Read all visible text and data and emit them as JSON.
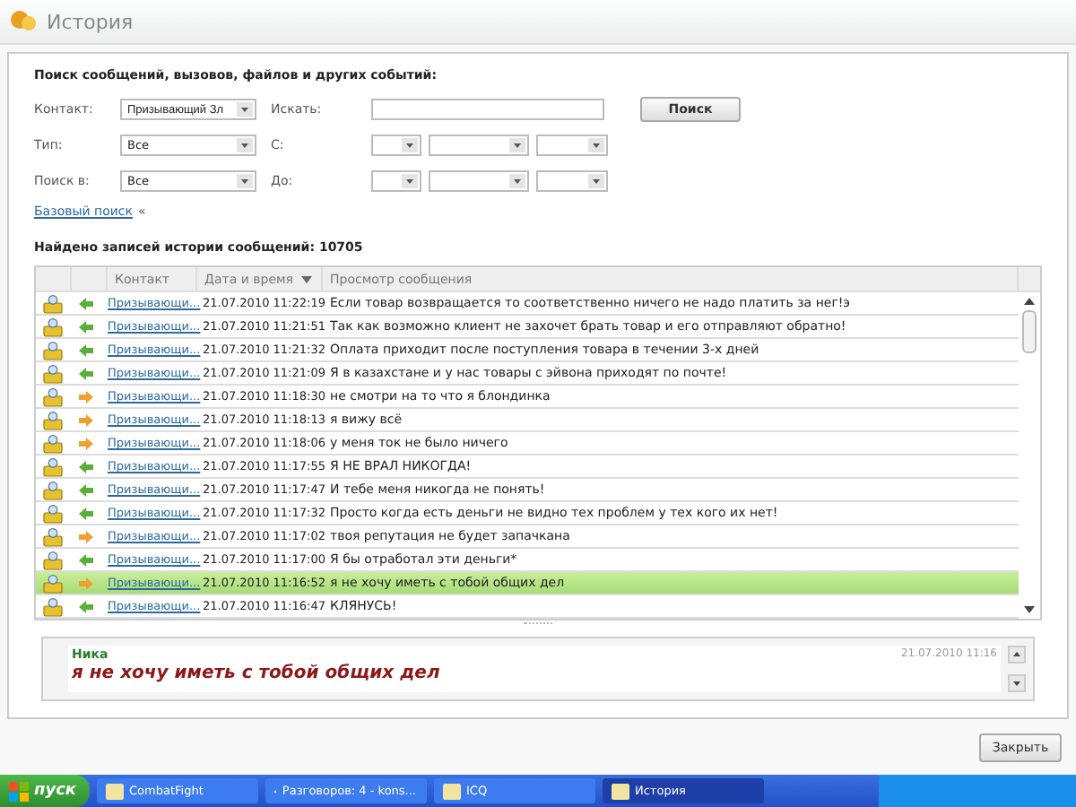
{
  "window": {
    "title": "История"
  },
  "search": {
    "heading": "Поиск сообщений, вызовов, файлов и других событий:",
    "contact_label": "Контакт:",
    "contact_value": "Призывающий Зл",
    "query_label": "Искать:",
    "search_button": "Поиск",
    "type_label": "Тип:",
    "type_value": "Все",
    "from_label": "С:",
    "in_label": "Поиск в:",
    "in_value": "Все",
    "to_label": "До:",
    "basic_link": "Базовый поиск",
    "basic_arrow": "«"
  },
  "found": "Найдено записей истории сообщений: 10705",
  "table": {
    "columns": [
      "Контакт",
      "Дата и время",
      "Просмотр сообщения"
    ],
    "rows": [
      {
        "kind": "incoming",
        "contact": "Призывающи...",
        "time": "21.07.2010 11:22:19",
        "text": "Если товар возвращается то соответственно ничего не надо платить за нег!э",
        "selected": false
      },
      {
        "kind": "incoming",
        "contact": "Призывающи...",
        "time": "21.07.2010 11:21:51",
        "text": "Так как возможно клиент не захочет брать товар и его отправляют обратно!",
        "selected": false
      },
      {
        "kind": "incoming",
        "contact": "Призывающи...",
        "time": "21.07.2010 11:21:32",
        "text": "Оплата приходит после поступления товара в течении 3-х дней",
        "selected": false
      },
      {
        "kind": "incoming",
        "contact": "Призывающи...",
        "time": "21.07.2010 11:21:09",
        "text": "Я в казахстане и у нас товары с эйвона приходят по почте!",
        "selected": false
      },
      {
        "kind": "outgoing",
        "contact": "Призывающи...",
        "time": "21.07.2010 11:18:30",
        "text": "не смотри на то что я блондинка",
        "selected": false
      },
      {
        "kind": "outgoing",
        "contact": "Призывающи...",
        "time": "21.07.2010 11:18:13",
        "text": "я вижу всё",
        "selected": false
      },
      {
        "kind": "outgoing",
        "contact": "Призывающи...",
        "time": "21.07.2010 11:18:06",
        "text": "у меня ток не было ничего",
        "selected": false
      },
      {
        "kind": "incoming",
        "contact": "Призывающи...",
        "time": "21.07.2010 11:17:55",
        "text": "Я НЕ ВРАЛ НИКОГДА!",
        "selected": false
      },
      {
        "kind": "incoming",
        "contact": "Призывающи...",
        "time": "21.07.2010 11:17:47",
        "text": "И тебе меня никогда не понять!",
        "selected": false
      },
      {
        "kind": "incoming",
        "contact": "Призывающи...",
        "time": "21.07.2010 11:17:32",
        "text": "Просто когда есть деньги не видно тех проблем у тех кого их нет!",
        "selected": false
      },
      {
        "kind": "outgoing",
        "contact": "Призывающи...",
        "time": "21.07.2010 11:17:02",
        "text": "твоя репутация не будет запачкана",
        "selected": false
      },
      {
        "kind": "incoming",
        "contact": "Призывающи...",
        "time": "21.07.2010 11:17:00",
        "text": "Я бы отработал эти деньги*",
        "selected": false
      },
      {
        "kind": "outgoing",
        "contact": "Призывающи...",
        "time": "21.07.2010 11:16:52",
        "text": "я не хочу иметь с тобой общих дел",
        "selected": true
      },
      {
        "kind": "incoming",
        "contact": "Призывающи...",
        "time": "21.07.2010 11:16:47",
        "text": "КЛЯНУСЬ!",
        "selected": false
      }
    ]
  },
  "preview": {
    "sender": "Ника",
    "time": "21.07.2010 11:16",
    "message": "я не хочу иметь с тобой общих дел"
  },
  "close_button": "Закрыть",
  "taskbar": {
    "start": "пуск",
    "items": [
      {
        "label": "CombatFight",
        "selected": false
      },
      {
        "label": "Разговоров: 4 - kons...",
        "selected": false
      },
      {
        "label": "ICQ",
        "selected": false
      },
      {
        "label": "История",
        "selected": true
      }
    ]
  }
}
